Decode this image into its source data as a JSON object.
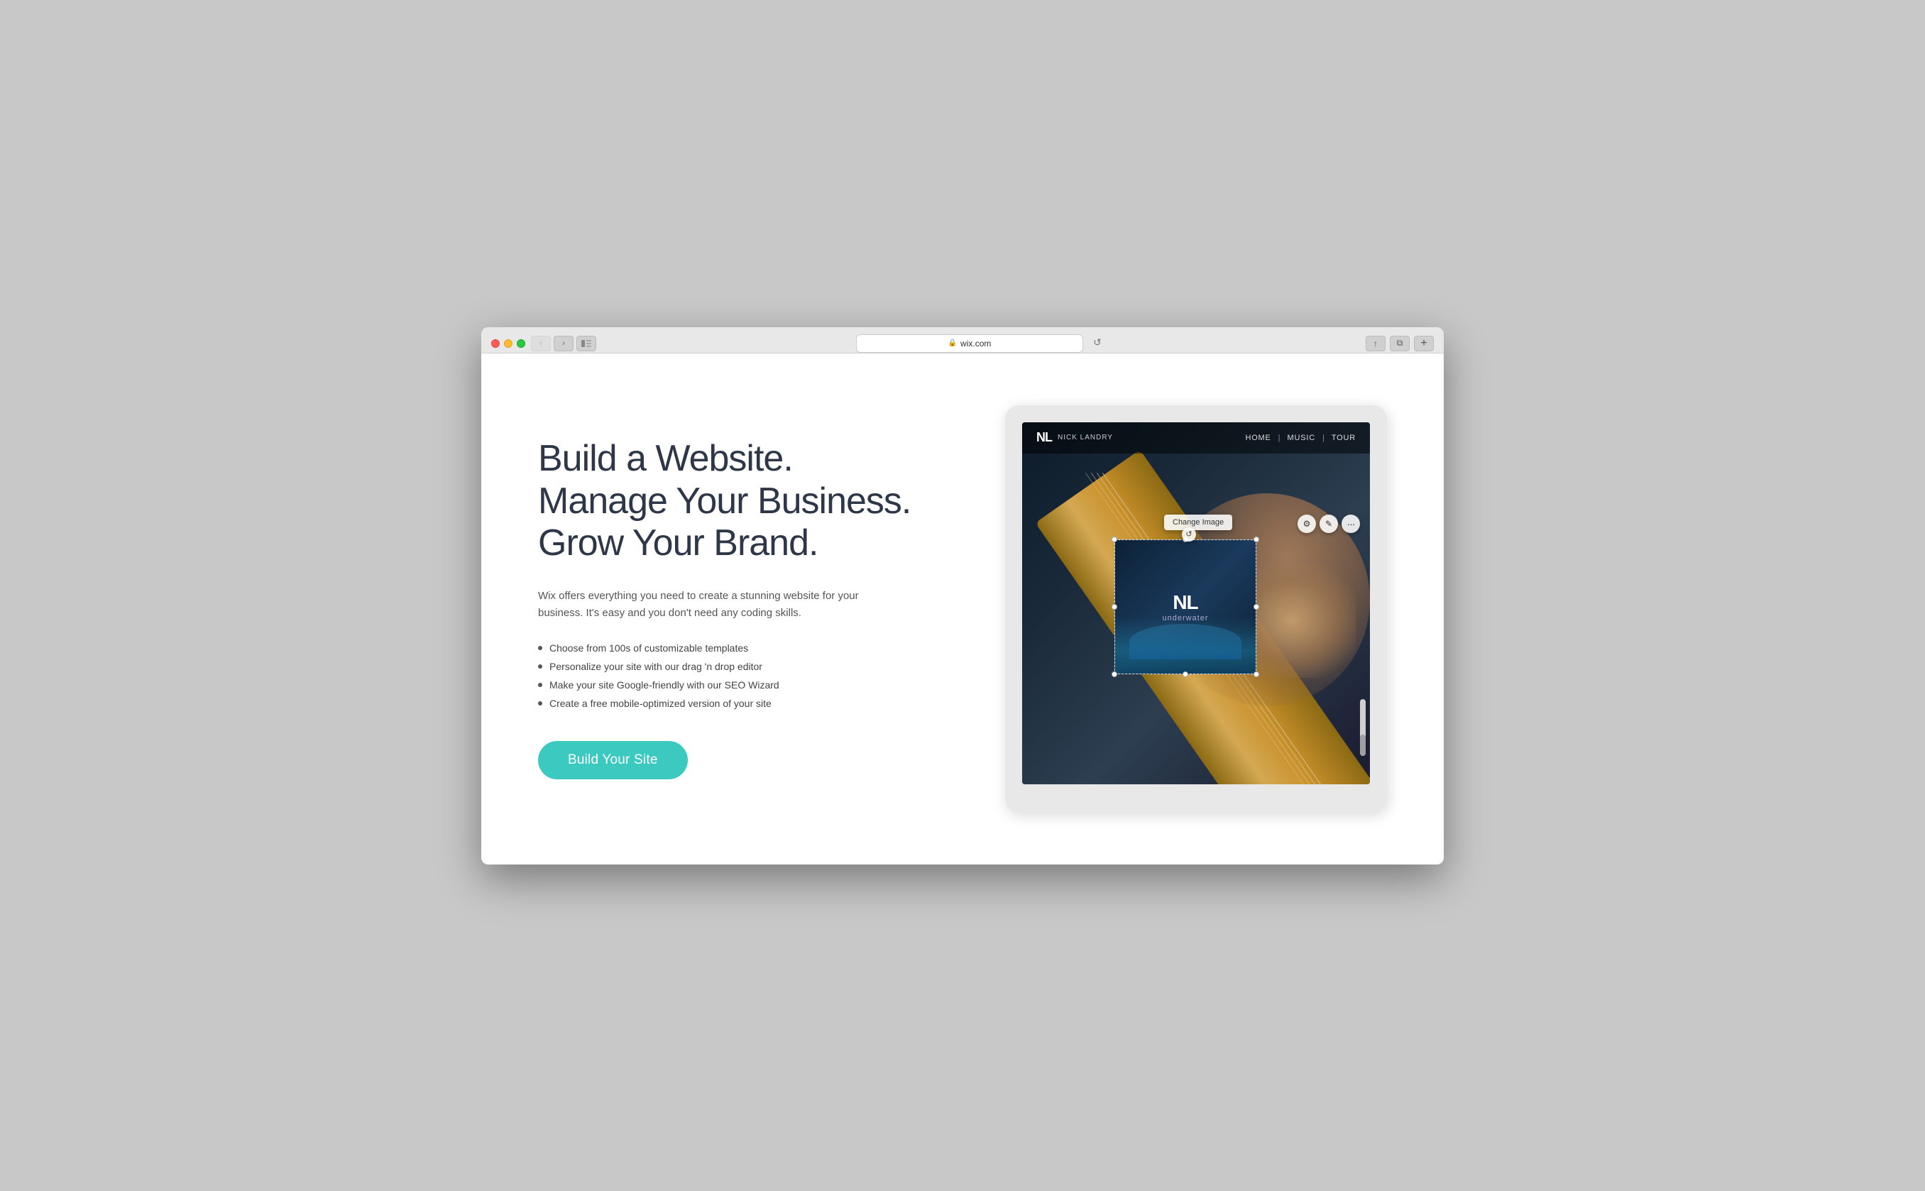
{
  "browser": {
    "url": "wix.com",
    "back_btn": "‹",
    "forward_btn": "›",
    "reload_btn": "↺",
    "share_btn": "↑",
    "tab_btn": "⧉",
    "add_tab_btn": "+"
  },
  "page": {
    "headline_line1": "Build a Website.",
    "headline_line2": "Manage Your Business.",
    "headline_line3": "Grow Your Brand.",
    "description": "Wix offers everything you need to create a stunning website for your business. It's easy and you don't need any coding skills.",
    "features": [
      "Choose from 100s of customizable templates",
      "Personalize your site with our drag 'n drop editor",
      "Make your site Google-friendly with our SEO Wizard",
      "Create a free mobile-optimized version of your site"
    ],
    "cta_label": "Build Your Site"
  },
  "site_preview": {
    "logo_initials": "NL",
    "logo_name": "NICK LANDRY",
    "nav_links": [
      "HOME",
      "MUSIC",
      "TOUR"
    ],
    "album_title": "NL",
    "album_subtitle": "underwater",
    "change_image_label": "Change Image"
  },
  "colors": {
    "cta_bg": "#3bc9c0",
    "headline": "#2d3748",
    "body_text": "#555555",
    "bullet": "#555555"
  }
}
